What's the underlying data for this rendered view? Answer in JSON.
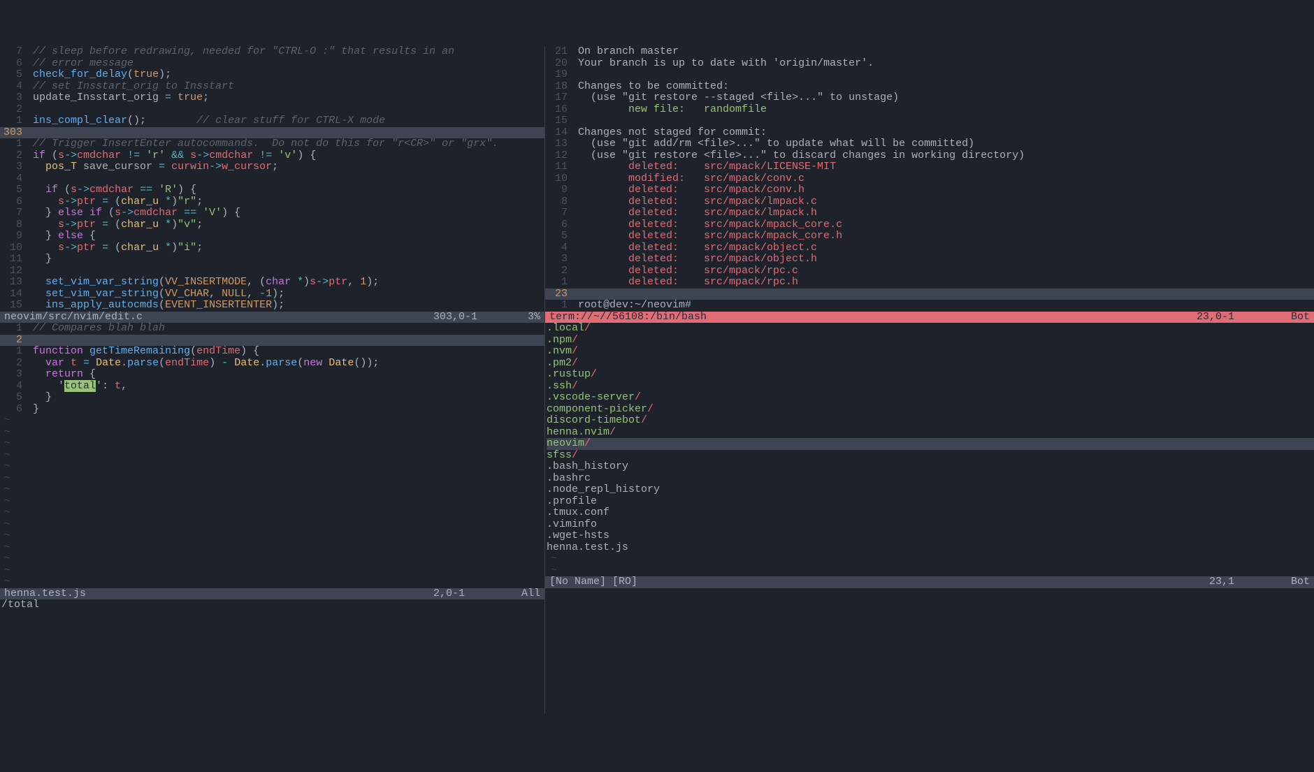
{
  "left_top": {
    "status_file": "neovim/src/nvim/edit.c",
    "status_pos": "303,0-1",
    "status_pct": "3%",
    "cursor_abs": "303",
    "pre_lines": [
      {
        "rel": "7",
        "html": "<span class='cm'>// sleep before redrawing, needed for \"CTRL-O :\" that results in an</span>"
      },
      {
        "rel": "6",
        "html": "<span class='cm'>// error message</span>"
      },
      {
        "rel": "5",
        "html": "<span class='fn'>check_for_delay</span><span class='var'>(</span><span class='const'>true</span><span class='var'>);</span>"
      },
      {
        "rel": "4",
        "html": "<span class='cm'>// set Insstart_orig to Insstart</span>"
      },
      {
        "rel": "3",
        "html": "<span class='var'>update_Insstart_orig </span><span class='op'>=</span><span class='var'> </span><span class='const'>true</span><span class='var'>;</span>"
      },
      {
        "rel": "2",
        "html": ""
      },
      {
        "rel": "1",
        "html": "<span class='fn'>ins_compl_clear</span><span class='var'>();        </span><span class='cm'>// clear stuff for CTRL-X mode</span>"
      }
    ],
    "post_lines": [
      {
        "rel": "1",
        "html": "<span class='cm'>// Trigger InsertEnter autocommands.  Do not do this for \"r&lt;CR&gt;\" or \"grx\".</span>"
      },
      {
        "rel": "2",
        "html": "<span class='kw'>if</span><span class='var'> (</span><span class='id'>s</span><span class='op'>-&gt;</span><span class='id'>cmdchar</span><span class='var'> </span><span class='op'>!=</span><span class='var'> </span><span class='str'>'r'</span><span class='var'> </span><span class='op'>&amp;&amp;</span><span class='var'> </span><span class='id'>s</span><span class='op'>-&gt;</span><span class='id'>cmdchar</span><span class='var'> </span><span class='op'>!=</span><span class='var'> </span><span class='str'>'v'</span><span class='var'>) {</span>"
      },
      {
        "rel": "3",
        "html": "  <span class='ty'>pos_T</span><span class='var'> save_cursor </span><span class='op'>=</span><span class='var'> </span><span class='id'>curwin</span><span class='op'>-&gt;</span><span class='id'>w_cursor</span><span class='var'>;</span>"
      },
      {
        "rel": "4",
        "html": ""
      },
      {
        "rel": "5",
        "html": "  <span class='kw'>if</span><span class='var'> (</span><span class='id'>s</span><span class='op'>-&gt;</span><span class='id'>cmdchar</span><span class='var'> </span><span class='op'>==</span><span class='var'> </span><span class='str'>'R'</span><span class='var'>) {</span>"
      },
      {
        "rel": "6",
        "html": "    <span class='id'>s</span><span class='op'>-&gt;</span><span class='id'>ptr</span><span class='var'> </span><span class='op'>=</span><span class='var'> (</span><span class='ty'>char_u</span><span class='var'> </span><span class='op'>*</span><span class='var'>)</span><span class='str'>\"r\"</span><span class='var'>;</span>"
      },
      {
        "rel": "7",
        "html": "  <span class='var'>} </span><span class='kw'>else if</span><span class='var'> (</span><span class='id'>s</span><span class='op'>-&gt;</span><span class='id'>cmdchar</span><span class='var'> </span><span class='op'>==</span><span class='var'> </span><span class='str'>'V'</span><span class='var'>) {</span>"
      },
      {
        "rel": "8",
        "html": "    <span class='id'>s</span><span class='op'>-&gt;</span><span class='id'>ptr</span><span class='var'> </span><span class='op'>=</span><span class='var'> (</span><span class='ty'>char_u</span><span class='var'> </span><span class='op'>*</span><span class='var'>)</span><span class='str'>\"v\"</span><span class='var'>;</span>"
      },
      {
        "rel": "9",
        "html": "  <span class='var'>} </span><span class='kw'>else</span><span class='var'> {</span>"
      },
      {
        "rel": "10",
        "html": "    <span class='id'>s</span><span class='op'>-&gt;</span><span class='id'>ptr</span><span class='var'> </span><span class='op'>=</span><span class='var'> (</span><span class='ty'>char_u</span><span class='var'> </span><span class='op'>*</span><span class='var'>)</span><span class='str'>\"i\"</span><span class='var'>;</span>"
      },
      {
        "rel": "11",
        "html": "  <span class='var'>}</span>"
      },
      {
        "rel": "12",
        "html": ""
      },
      {
        "rel": "13",
        "html": "  <span class='fn'>set_vim_var_string</span><span class='var'>(</span><span class='const'>VV_INSERTMODE</span><span class='var'>, (</span><span class='kw'>char</span><span class='var'> </span><span class='op'>*</span><span class='var'>)</span><span class='id'>s</span><span class='op'>-&gt;</span><span class='id'>ptr</span><span class='var'>, </span><span class='num'>1</span><span class='var'>);</span>"
      },
      {
        "rel": "14",
        "html": "  <span class='fn'>set_vim_var_string</span><span class='var'>(</span><span class='const'>VV_CHAR</span><span class='var'>, </span><span class='const'>NULL</span><span class='var'>, </span><span class='op'>-</span><span class='num'>1</span><span class='var'>);</span>"
      },
      {
        "rel": "15",
        "html": "  <span class='fn'>ins_apply_autocmds</span><span class='var'>(</span><span class='const'>EVENT_INSERTENTER</span><span class='var'>);</span>"
      }
    ]
  },
  "left_bottom": {
    "status_file": "henna.test.js",
    "status_pos": "2,0-1",
    "status_pct": "All",
    "cursor_abs": "2",
    "pre_lines": [
      {
        "rel": "1",
        "html": "<span class='cm'>// Compares blah blah</span>"
      }
    ],
    "post_lines": [
      {
        "rel": "1",
        "html": "<span class='kw'>function</span><span class='var'> </span><span class='fn'>getTimeRemaining</span><span class='var'>(</span><span class='id'>endTime</span><span class='var'>) {</span>"
      },
      {
        "rel": "2",
        "html": "  <span class='kw'>var</span><span class='var'> </span><span class='id'>t</span><span class='var'> </span><span class='op'>=</span><span class='var'> </span><span class='ty'>Date</span><span class='var'>.</span><span class='fn'>parse</span><span class='var'>(</span><span class='id'>endTime</span><span class='var'>) </span><span class='op'>-</span><span class='var'> </span><span class='ty'>Date</span><span class='var'>.</span><span class='fn'>parse</span><span class='var'>(</span><span class='kw'>new</span><span class='var'> </span><span class='ty'>Date</span><span class='var'>());</span>"
      },
      {
        "rel": "3",
        "html": "  <span class='kw'>return</span><span class='var'> {</span>"
      },
      {
        "rel": "4",
        "html": "    <span class='str'>'</span><span class='hl'>total</span><span class='str'>'</span><span class='var'>: </span><span class='id'>t</span><span class='var'>,</span>"
      },
      {
        "rel": "5",
        "html": "  <span class='var'>}</span>"
      },
      {
        "rel": "6",
        "html": "<span class='var'>}</span>"
      }
    ],
    "tildes": 15
  },
  "right_top": {
    "status_file": "term://~//56108:/bin/bash",
    "status_pos": "23,0-1",
    "status_pct": "Bot",
    "cursor_abs": "23",
    "prompt": "root@dev:~/neovim#",
    "lines": [
      {
        "rel": "21",
        "html": "<span class='var'>On branch master</span>"
      },
      {
        "rel": "20",
        "html": "<span class='var'>Your branch is up to date with 'origin/master'.</span>"
      },
      {
        "rel": "19",
        "html": ""
      },
      {
        "rel": "18",
        "html": "<span class='var'>Changes to be committed:</span>"
      },
      {
        "rel": "17",
        "html": "<span class='var'>  (use \"git restore --staged &lt;file&gt;...\" to unstage)</span>"
      },
      {
        "rel": "16",
        "html": "        <span class='grn'>new file:   randomfile</span>"
      },
      {
        "rel": "15",
        "html": ""
      },
      {
        "rel": "14",
        "html": "<span class='var'>Changes not staged for commit:</span>"
      },
      {
        "rel": "13",
        "html": "<span class='var'>  (use \"git add/rm &lt;file&gt;...\" to update what will be committed)</span>"
      },
      {
        "rel": "12",
        "html": "<span class='var'>  (use \"git restore &lt;file&gt;...\" to discard changes in working directory)</span>"
      },
      {
        "rel": "11",
        "html": "        <span class='red'>deleted:    src/mpack/LICENSE-MIT</span>"
      },
      {
        "rel": "10",
        "html": "        <span class='red'>modified:   src/mpack/conv.c</span>"
      },
      {
        "rel": "9",
        "html": "        <span class='red'>deleted:    src/mpack/conv.h</span>"
      },
      {
        "rel": "8",
        "html": "        <span class='red'>deleted:    src/mpack/lmpack.c</span>"
      },
      {
        "rel": "7",
        "html": "        <span class='red'>deleted:    src/mpack/lmpack.h</span>"
      },
      {
        "rel": "6",
        "html": "        <span class='red'>deleted:    src/mpack/mpack_core.c</span>"
      },
      {
        "rel": "5",
        "html": "        <span class='red'>deleted:    src/mpack/mpack_core.h</span>"
      },
      {
        "rel": "4",
        "html": "        <span class='red'>deleted:    src/mpack/object.c</span>"
      },
      {
        "rel": "3",
        "html": "        <span class='red'>deleted:    src/mpack/object.h</span>"
      },
      {
        "rel": "2",
        "html": "        <span class='red'>deleted:    src/mpack/rpc.c</span>"
      },
      {
        "rel": "1",
        "html": "        <span class='red'>deleted:    src/mpack/rpc.h</span>"
      }
    ]
  },
  "right_bottom": {
    "status_file": "[No Name] [RO]",
    "status_pos": "23,1",
    "status_pct": "Bot",
    "entries": [
      {
        "name": ".local",
        "dir": true
      },
      {
        "name": ".npm",
        "dir": true
      },
      {
        "name": ".nvm",
        "dir": true
      },
      {
        "name": ".pm2",
        "dir": true
      },
      {
        "name": ".rustup",
        "dir": true
      },
      {
        "name": ".ssh",
        "dir": true
      },
      {
        "name": ".vscode-server",
        "dir": true
      },
      {
        "name": "component-picker",
        "dir": true
      },
      {
        "name": "discord-timebot",
        "dir": true
      },
      {
        "name": "henna.nvim",
        "dir": true
      },
      {
        "name": "neovim",
        "dir": true,
        "sel": true
      },
      {
        "name": "sfss",
        "dir": true
      },
      {
        "name": ".bash_history",
        "dir": false
      },
      {
        "name": ".bashrc",
        "dir": false
      },
      {
        "name": ".node_repl_history",
        "dir": false
      },
      {
        "name": ".profile",
        "dir": false
      },
      {
        "name": ".tmux.conf",
        "dir": false
      },
      {
        "name": ".viminfo",
        "dir": false
      },
      {
        "name": ".wget-hsts",
        "dir": false
      },
      {
        "name": "henna.test.js",
        "dir": false
      }
    ],
    "tildes": 2
  },
  "cmdline": "/total"
}
